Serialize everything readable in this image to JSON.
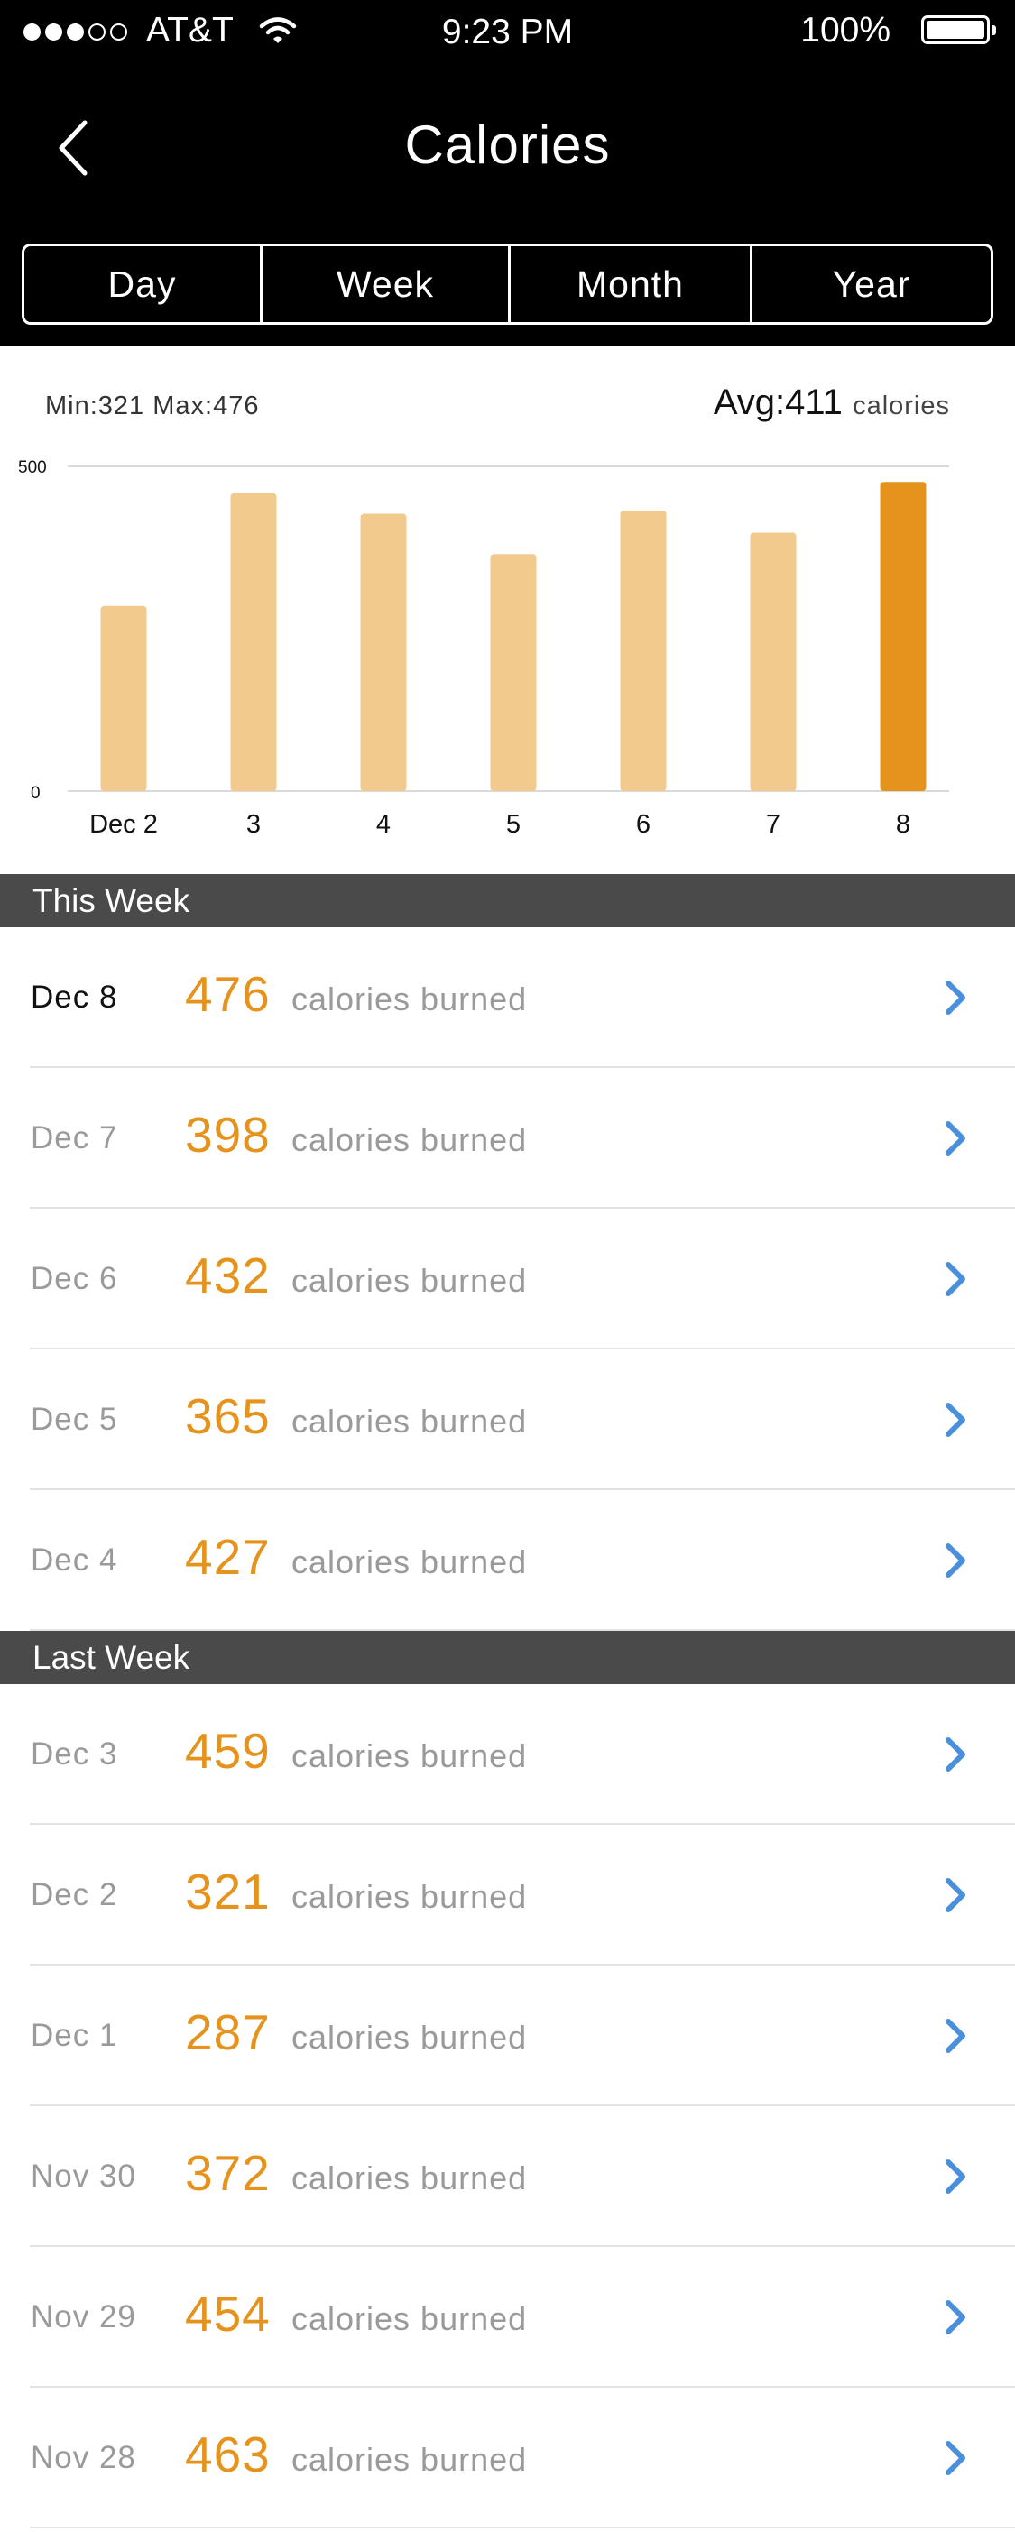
{
  "status_bar": {
    "carrier": "AT&T",
    "time": "9:23 PM",
    "battery": "100%",
    "signal_bars_filled": 3,
    "signal_bars_total": 5,
    "icons": [
      "wifi-icon",
      "battery-icon"
    ]
  },
  "nav": {
    "title": "Calories",
    "back_icon": "chevron-left-icon"
  },
  "segments": [
    {
      "label": "Day",
      "active": false
    },
    {
      "label": "Week",
      "active": true
    },
    {
      "label": "Month",
      "active": false
    },
    {
      "label": "Year",
      "active": false
    }
  ],
  "summary": {
    "minmax": "Min:321 Max:476",
    "avg_label": "Avg:411",
    "avg_unit": "calories"
  },
  "chart_data": {
    "type": "bar",
    "categories": [
      "Dec 2",
      "3",
      "4",
      "5",
      "6",
      "7",
      "8"
    ],
    "values": [
      285,
      459,
      427,
      365,
      432,
      398,
      476
    ],
    "ylim": [
      0,
      500
    ],
    "yticks": [
      "0",
      "500"
    ],
    "highlight_index": 6,
    "colors": {
      "bar": "#f2ca8e",
      "highlight": "#e5931c",
      "grid": "#d9d9d9"
    }
  },
  "sections": [
    {
      "title": "This Week",
      "rows": [
        {
          "date": "Dec 8",
          "value": "476",
          "label": "calories burned",
          "current": true
        },
        {
          "date": "Dec 7",
          "value": "398",
          "label": "calories burned",
          "current": false
        },
        {
          "date": "Dec 6",
          "value": "432",
          "label": "calories burned",
          "current": false
        },
        {
          "date": "Dec 5",
          "value": "365",
          "label": "calories burned",
          "current": false
        },
        {
          "date": "Dec 4",
          "value": "427",
          "label": "calories burned",
          "current": false
        }
      ]
    },
    {
      "title": "Last Week",
      "rows": [
        {
          "date": "Dec 3",
          "value": "459",
          "label": "calories burned",
          "current": false
        },
        {
          "date": "Dec 2",
          "value": "321",
          "label": "calories burned",
          "current": false
        },
        {
          "date": "Dec 1",
          "value": "287",
          "label": "calories burned",
          "current": false
        },
        {
          "date": "Nov 30",
          "value": "372",
          "label": "calories burned",
          "current": false
        },
        {
          "date": "Nov 29",
          "value": "454",
          "label": "calories burned",
          "current": false
        },
        {
          "date": "Nov 28",
          "value": "463",
          "label": "calories burned",
          "current": false
        }
      ]
    }
  ],
  "theme": {
    "accent": "#e5931c",
    "chevron": "#4a8fdb",
    "section_header_bg": "#4a4a4a"
  }
}
